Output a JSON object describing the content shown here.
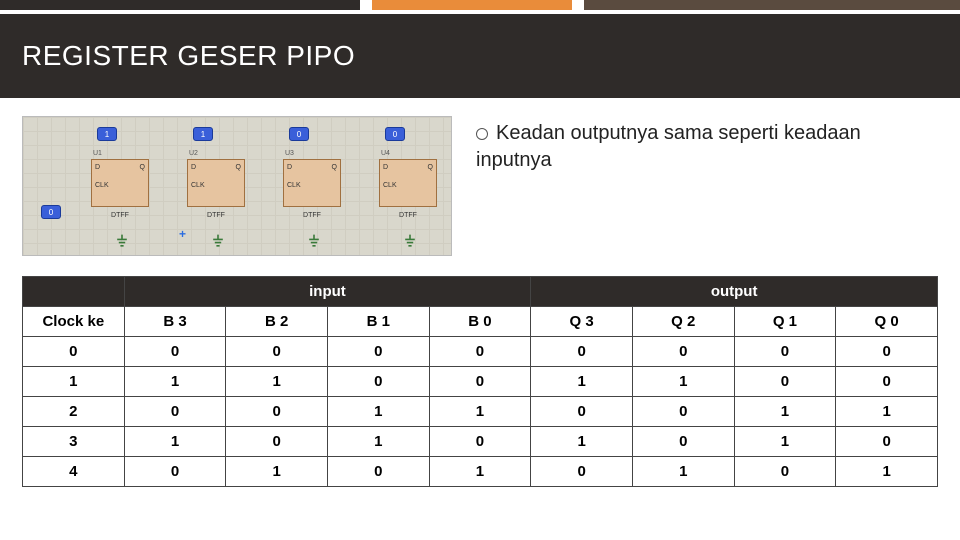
{
  "title": "REGISTER GESER PIPO",
  "bullet_text": "Keadan outputnya sama seperti keadaan inputnya",
  "diagram": {
    "units": [
      "U1",
      "U2",
      "U3",
      "U4"
    ],
    "pin_d": "D",
    "pin_q": "Q",
    "pin_clk": "CLK",
    "chip_label": "DTFF",
    "logic_hi": "1",
    "logic_lo": "0",
    "clk_tag": "0"
  },
  "table": {
    "group_blank": "",
    "group_input": "input",
    "group_output": "output",
    "headers": [
      "Clock ke",
      "B 3",
      "B 2",
      "B 1",
      "B 0",
      "Q 3",
      "Q 2",
      "Q 1",
      "Q 0"
    ],
    "rows": [
      [
        "0",
        "0",
        "0",
        "0",
        "0",
        "0",
        "0",
        "0",
        "0"
      ],
      [
        "1",
        "1",
        "1",
        "0",
        "0",
        "1",
        "1",
        "0",
        "0"
      ],
      [
        "2",
        "0",
        "0",
        "1",
        "1",
        "0",
        "0",
        "1",
        "1"
      ],
      [
        "3",
        "1",
        "0",
        "1",
        "0",
        "1",
        "0",
        "1",
        "0"
      ],
      [
        "4",
        "0",
        "1",
        "0",
        "1",
        "0",
        "1",
        "0",
        "1"
      ]
    ]
  }
}
